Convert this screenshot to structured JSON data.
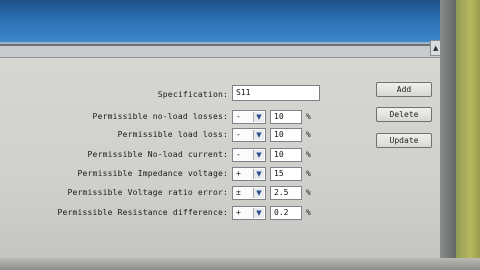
{
  "form": {
    "specification": {
      "label": "Specification:",
      "value": "S11"
    },
    "rows": [
      {
        "label": "Permissible no-load losses:",
        "sign": "-",
        "value": "10",
        "unit": "%"
      },
      {
        "label": "Permissible load loss:",
        "sign": "-",
        "value": "10",
        "unit": "%"
      },
      {
        "label": "Permissible No-load current:",
        "sign": "-",
        "value": "10",
        "unit": "%"
      },
      {
        "label": "Permissible Impedance voltage:",
        "sign": "+",
        "value": "15",
        "unit": "%"
      },
      {
        "label": "Permissible Voltage ratio error:",
        "sign": "±",
        "value": "2.5",
        "unit": "%"
      },
      {
        "label": "Permissible Resistance difference:",
        "sign": "+",
        "value": "0.2",
        "unit": "%"
      }
    ]
  },
  "buttons": {
    "add": "Add",
    "delete": "Delete",
    "update": "Update"
  },
  "icons": {
    "select_arrow": "chevron-down-icon",
    "scroll_arrow": "scroll-up-icon"
  }
}
